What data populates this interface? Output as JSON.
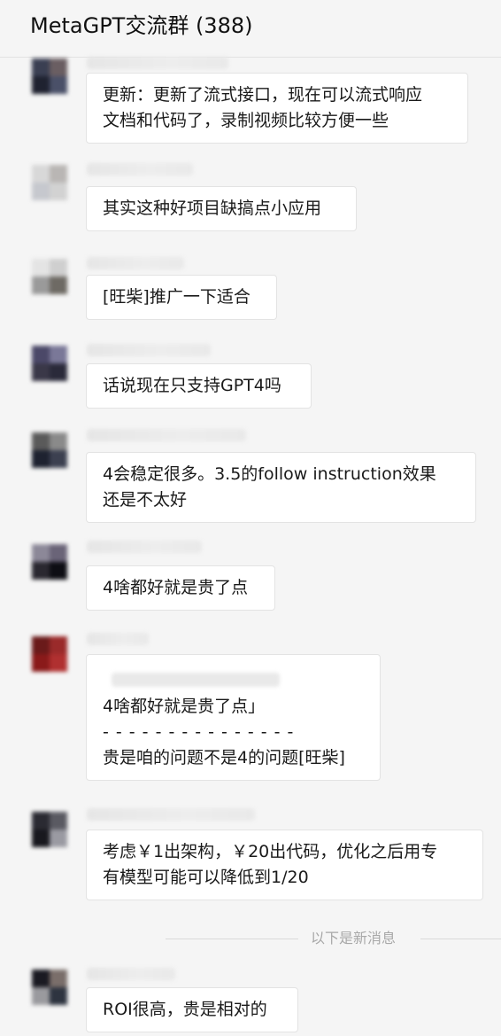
{
  "header": {
    "title": "MetaGPT交流群 (388)"
  },
  "messages": [
    {
      "lines": [
        "更新：更新了流式接口，现在可以流式响应",
        "文档和代码了，录制视频比较方便一些"
      ]
    },
    {
      "lines": [
        "其实这种好项目缺搞点小应用"
      ]
    },
    {
      "lines": [
        "[旺柴]推广一下适合"
      ]
    },
    {
      "lines": [
        "话说现在只支持GPT4吗"
      ]
    },
    {
      "lines": [
        "4会稳定很多。3.5的follow instruction效果",
        "还是不太好"
      ]
    },
    {
      "lines": [
        "4啥都好就是贵了点"
      ]
    },
    {
      "quote": "4啥都好就是贵了点」",
      "separator": "- - - - - - - - - - - - - - -",
      "reply": "贵是咱的问题不是4的问题[旺柴]"
    },
    {
      "lines": [
        "考虑￥1出架构，￥20出代码，优化之后用专",
        "有模型可能可以降低到1/20"
      ]
    },
    {
      "lines": [
        "ROI很高，贵是相对的"
      ]
    }
  ],
  "divider": {
    "label": "以下是新消息"
  },
  "colors": {
    "background": "#f5f5f5",
    "bubble": "#ffffff",
    "bubble_border": "#e3e3e3",
    "divider_text": "#a8a8a8"
  }
}
